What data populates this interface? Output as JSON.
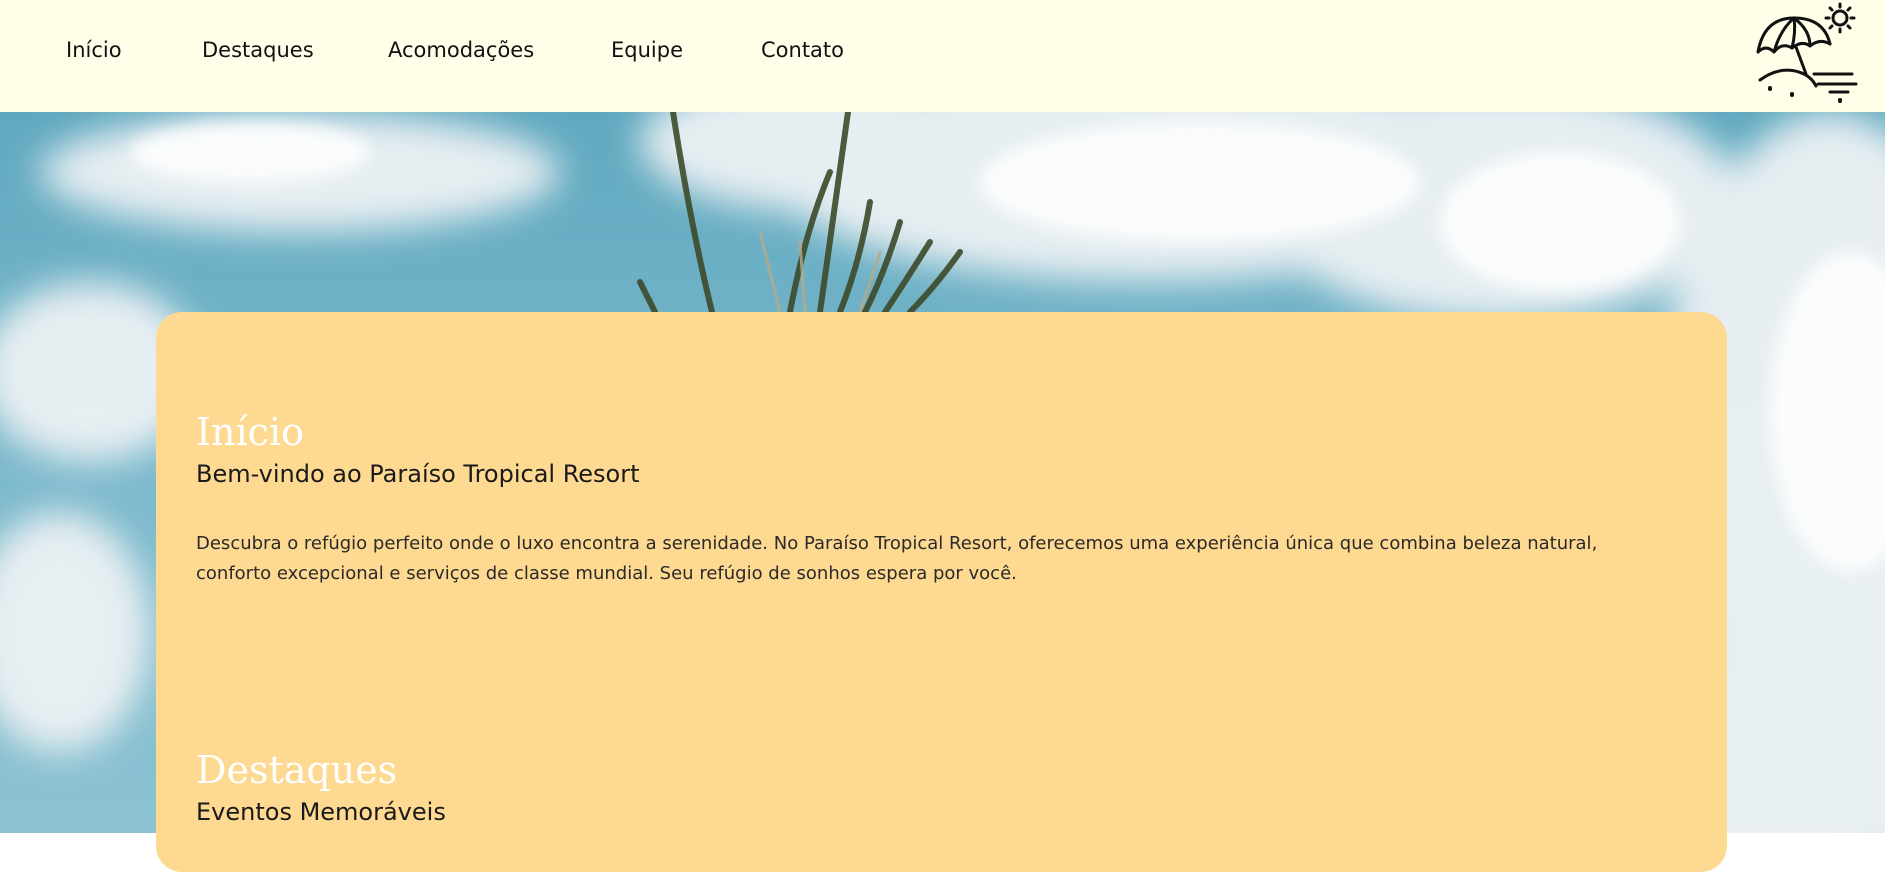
{
  "nav": {
    "items": [
      {
        "label": "Início"
      },
      {
        "label": "Destaques"
      },
      {
        "label": "Acomodações"
      },
      {
        "label": "Equipe"
      },
      {
        "label": "Contato"
      }
    ],
    "logo_icon": "beach-umbrella-sun-icon"
  },
  "hero": {
    "background": "sky-clouds-palm-photo"
  },
  "sections": {
    "inicio": {
      "title": "Início",
      "subtitle": "Bem-vindo ao Paraíso Tropical Resort",
      "body": "Descubra o refúgio perfeito onde o luxo encontra a serenidade. No Paraíso Tropical Resort, oferecemos uma experiência única que combina beleza natural, conforto excepcional e serviços de classe mundial. Seu refúgio de sonhos espera por você."
    },
    "destaques": {
      "title": "Destaques",
      "subtitle": "Eventos Memoráveis"
    }
  },
  "colors": {
    "navbar_bg": "#fffee8",
    "card_bg": "#fed991",
    "title_color": "#ffffff",
    "text_color": "#1a1a1a"
  }
}
